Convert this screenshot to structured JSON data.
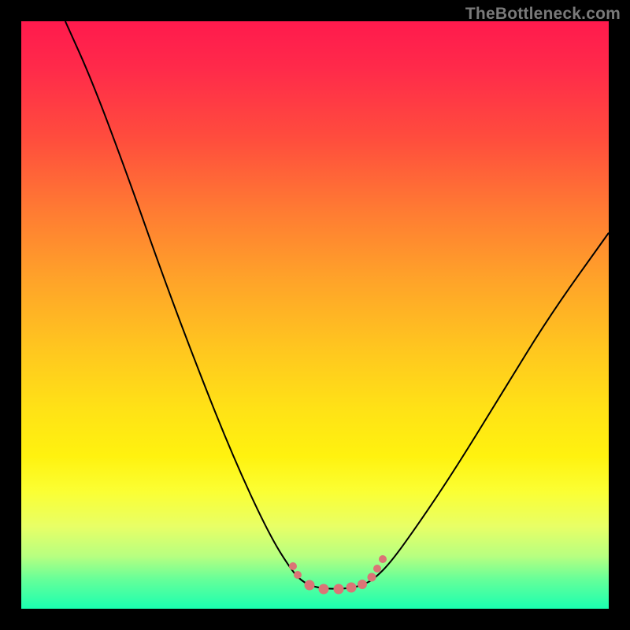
{
  "watermark": "TheBottleneck.com",
  "chart_data": {
    "type": "line",
    "title": "",
    "xlabel": "",
    "ylabel": "",
    "x_range": [
      0,
      100
    ],
    "y_range": [
      0,
      100
    ],
    "grid": false,
    "curve": {
      "comment": "Normalized 0..100 coordinates of the V-shaped bottleneck curve; 0,0 is bottom-left of the gradient plot area.",
      "points": [
        {
          "x": 7.5,
          "y": 100.0
        },
        {
          "x": 12.0,
          "y": 90.0
        },
        {
          "x": 18.0,
          "y": 74.0
        },
        {
          "x": 24.0,
          "y": 57.0
        },
        {
          "x": 30.0,
          "y": 41.0
        },
        {
          "x": 36.0,
          "y": 26.0
        },
        {
          "x": 42.0,
          "y": 13.0
        },
        {
          "x": 46.0,
          "y": 6.5
        },
        {
          "x": 48.0,
          "y": 4.5
        },
        {
          "x": 50.0,
          "y": 3.7
        },
        {
          "x": 52.0,
          "y": 3.4
        },
        {
          "x": 54.0,
          "y": 3.4
        },
        {
          "x": 56.0,
          "y": 3.5
        },
        {
          "x": 58.0,
          "y": 4.0
        },
        {
          "x": 60.0,
          "y": 5.0
        },
        {
          "x": 63.0,
          "y": 8.0
        },
        {
          "x": 68.0,
          "y": 15.0
        },
        {
          "x": 74.0,
          "y": 24.0
        },
        {
          "x": 82.0,
          "y": 37.0
        },
        {
          "x": 90.0,
          "y": 50.0
        },
        {
          "x": 100.0,
          "y": 64.0
        }
      ]
    },
    "markers": {
      "comment": "Pink circular markers clustered at the trough of the curve.",
      "color": "#db7476",
      "points": [
        {
          "x": 46.3,
          "y": 7.2,
          "r": 5.0
        },
        {
          "x": 47.0,
          "y": 5.8,
          "r": 5.0
        },
        {
          "x": 49.0,
          "y": 4.0,
          "r": 6.5
        },
        {
          "x": 51.5,
          "y": 3.4,
          "r": 6.5
        },
        {
          "x": 54.0,
          "y": 3.4,
          "r": 6.5
        },
        {
          "x": 56.2,
          "y": 3.6,
          "r": 6.5
        },
        {
          "x": 58.0,
          "y": 4.2,
          "r": 6.0
        },
        {
          "x": 59.6,
          "y": 5.4,
          "r": 5.5
        },
        {
          "x": 60.6,
          "y": 6.8,
          "r": 5.0
        },
        {
          "x": 61.5,
          "y": 8.4,
          "r": 5.0
        }
      ]
    }
  }
}
